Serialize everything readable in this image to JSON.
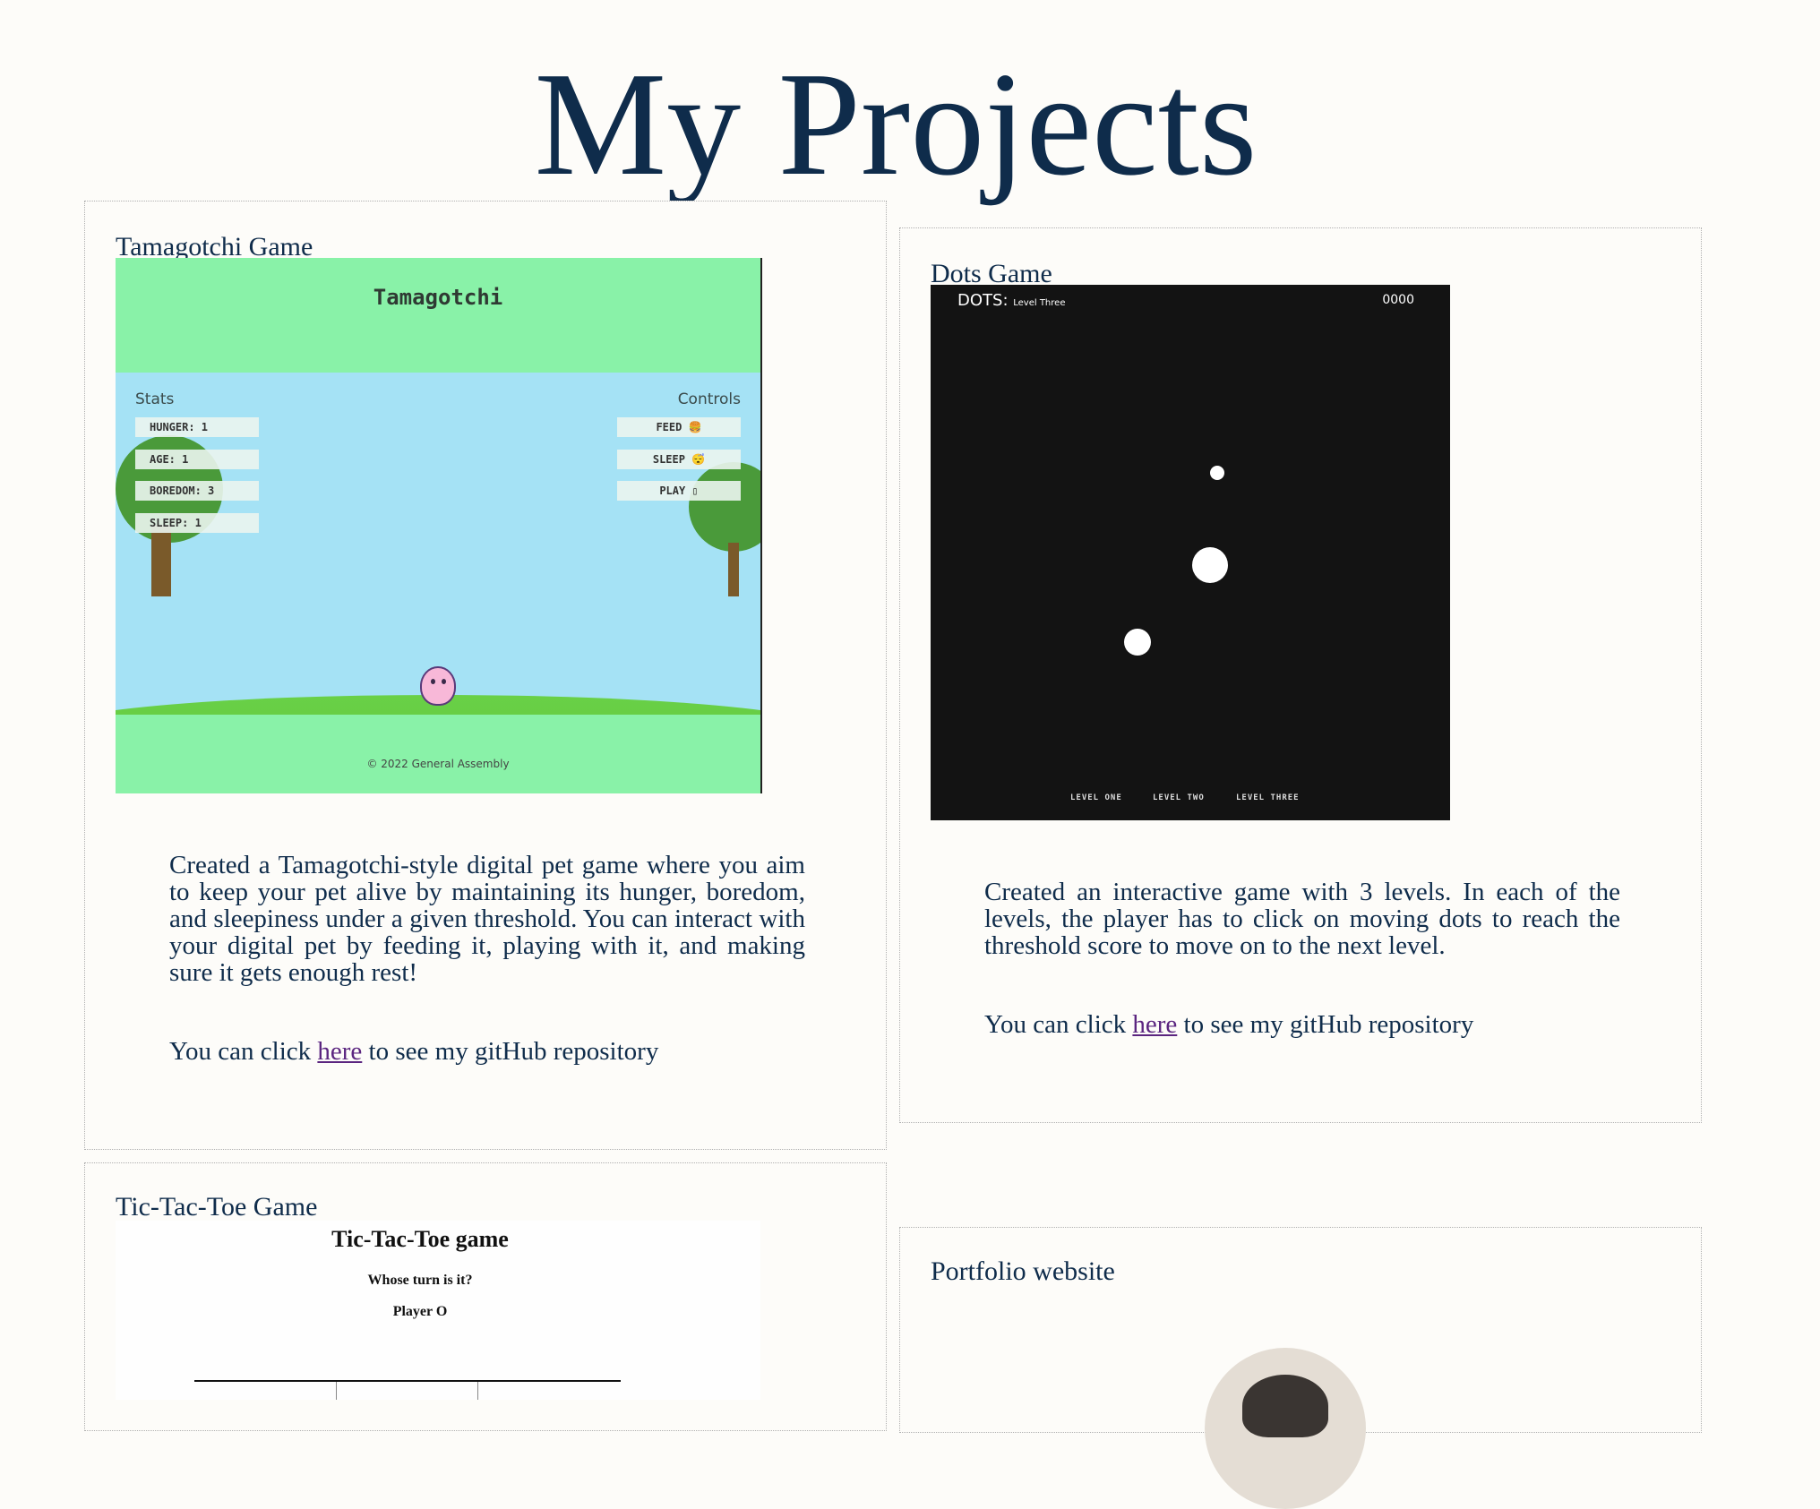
{
  "page": {
    "title": "My Projects"
  },
  "colors": {
    "text": "#0f2c4b",
    "link": "#5b2580",
    "background": "#fdfcf9"
  },
  "projects": [
    {
      "title": "Tamagotchi Game",
      "screenshot": {
        "app_title": "Tamagotchi",
        "stats_label": "Stats",
        "controls_label": "Controls",
        "stats": [
          "HUNGER: 1",
          "AGE: 1",
          "BOREDOM: 3",
          "SLEEP: 1"
        ],
        "controls": [
          "FEED 🍔",
          "SLEEP 😴",
          "PLAY ▯"
        ],
        "footer": "© 2022 General Assembly"
      },
      "description": "Created a Tamagotchi-style digital pet game where you aim to keep your pet alive by maintaining its hunger, boredom, and sleepiness under a given threshold. You can interact with your digital pet by feeding it, playing with it, and making sure it gets enough rest!",
      "link_prefix": "You can click ",
      "link_text": "here",
      "link_suffix": " to see my gitHub repository"
    },
    {
      "title": "Dots Game",
      "screenshot": {
        "game_title": "DOTS:",
        "level_name": "Level Three",
        "score": "0000",
        "levels": [
          "LEVEL ONE",
          "LEVEL TWO",
          "LEVEL THREE"
        ]
      },
      "description": "Created an interactive game with 3 levels. In each of the levels, the player has to click on moving dots to reach the threshold score to move on to the next level.",
      "link_prefix": "You can click ",
      "link_text": "here",
      "link_suffix": " to see my gitHub repository"
    },
    {
      "title": "Tic-Tac-Toe Game",
      "screenshot": {
        "game_title": "Tic-Tac-Toe game",
        "question": "Whose turn is it?",
        "player": "Player O"
      }
    },
    {
      "title": "Portfolio website"
    }
  ]
}
